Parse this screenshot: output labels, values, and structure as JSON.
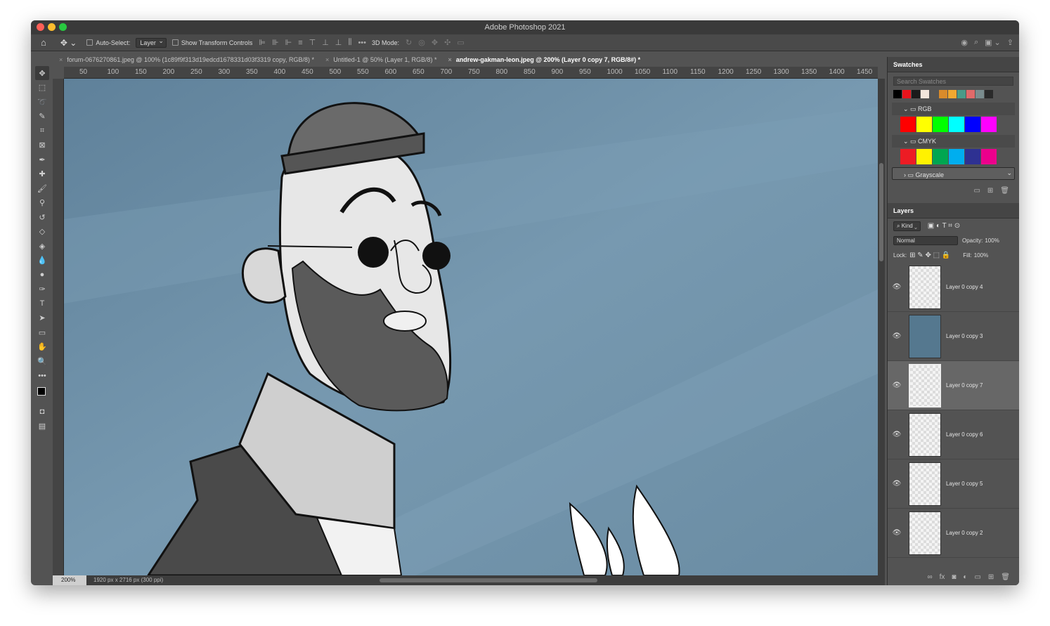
{
  "app": {
    "title": "Adobe Photoshop 2021"
  },
  "options": {
    "auto_select_label": "Auto-Select:",
    "auto_select_value": "Layer",
    "show_transform_label": "Show Transform Controls",
    "mode_3d": "3D Mode:"
  },
  "tabs": [
    {
      "label": "forum-0676270861.jpeg @ 100% (1c89f9f313d19edcd1678331d03f3319 copy, RGB/8) *"
    },
    {
      "label": "Untitled-1 @ 50% (Layer 1, RGB/8) *"
    },
    {
      "label": "andrew-gakman-leon.jpeg @ 200% (Layer 0 copy 7, RGB/8#) *"
    }
  ],
  "ruler": {
    "top": [
      "50",
      "100",
      "150",
      "200",
      "250",
      "300",
      "350",
      "400",
      "450",
      "500",
      "550",
      "600",
      "650",
      "700",
      "750",
      "800",
      "850",
      "900",
      "950",
      "1000",
      "1050",
      "1100",
      "1150",
      "1200",
      "1250",
      "1300",
      "1350",
      "1400",
      "1450"
    ]
  },
  "status": {
    "zoom": "200%",
    "doc_info": "1920 px x 2716 px (300 ppi)"
  },
  "swatches": {
    "title": "Swatches",
    "search_placeholder": "Search Swatches",
    "recent": [
      "#000000",
      "#e8141c",
      "#1a1a1a",
      "#f2e6dc",
      "#555555",
      "#d98b2b",
      "#f0a830",
      "#4a9a88",
      "#e06a6a",
      "#7a8c8e",
      "#2a2a2a"
    ],
    "groups": [
      {
        "name": "RGB",
        "colors": [
          "#ff0000",
          "#ffff00",
          "#00ff00",
          "#00ffff",
          "#0000ff",
          "#ff00ff"
        ]
      },
      {
        "name": "CMYK",
        "colors": [
          "#ed1c24",
          "#fff200",
          "#00a651",
          "#00aeef",
          "#2e3192",
          "#ec008c"
        ]
      },
      {
        "name": "Grayscale",
        "colors": []
      }
    ]
  },
  "layers": {
    "title": "Layers",
    "filter": "Kind",
    "blend_mode": "Normal",
    "opacity_label": "Opacity:",
    "opacity": "100%",
    "lock_label": "Lock:",
    "fill_label": "Fill:",
    "fill": "100%",
    "items": [
      {
        "name": "Layer 0 copy 4"
      },
      {
        "name": "Layer 0 copy 3"
      },
      {
        "name": "Layer 0 copy 7"
      },
      {
        "name": "Layer 0 copy 6"
      },
      {
        "name": "Layer 0 copy 5"
      },
      {
        "name": "Layer 0 copy 2"
      }
    ]
  }
}
